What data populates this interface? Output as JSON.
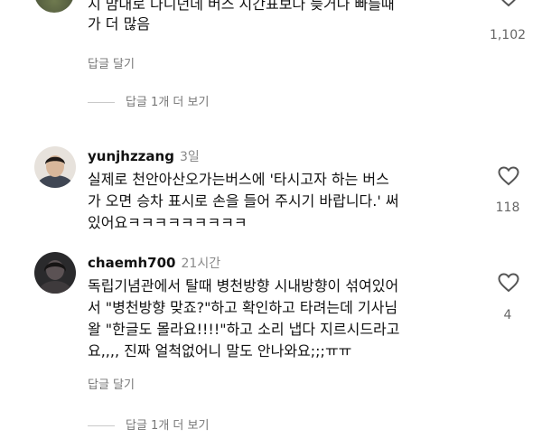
{
  "comments": [
    {
      "text_lines": [
        "지 맘대로 다니던데 버스 시간표보다 늦거나 빠를때",
        "가 더 많음"
      ],
      "likes": "1,102",
      "reply_label": "답글 달기",
      "view_replies": "답글 1개 더 보기"
    },
    {
      "username": "yunjhzzang",
      "time": "3일",
      "text_lines": [
        "실제로 천안아산오가는버스에 '타시고자 하는 버스",
        "가 오면 승차 표시로 손을 들어 주시기 바랍니다.' 써",
        "있어요ㅋㅋㅋㅋㅋㅋㅋㅋㅋ"
      ],
      "likes": "118"
    },
    {
      "username": "chaemh700",
      "time": "21시간",
      "text_lines": [
        "독립기념관에서 탈때 병천방향 시내방향이 섞여있어",
        "서 \"병천방향 맞죠?\"하고 확인하고 타려는데 기사님",
        "왈 \"한글도 몰라요!!!!\"하고 소리 냅다 지르시드라고",
        "요,,,, 진짜 얼척없어니 말도 안나와요;;;ㅠㅠ"
      ],
      "likes": "4",
      "reply_label": "답글 달기",
      "view_replies": "답글 1개 더 보기"
    }
  ],
  "colors": {
    "text": "#111111",
    "muted": "#777777",
    "heart_stroke": "#555555"
  }
}
